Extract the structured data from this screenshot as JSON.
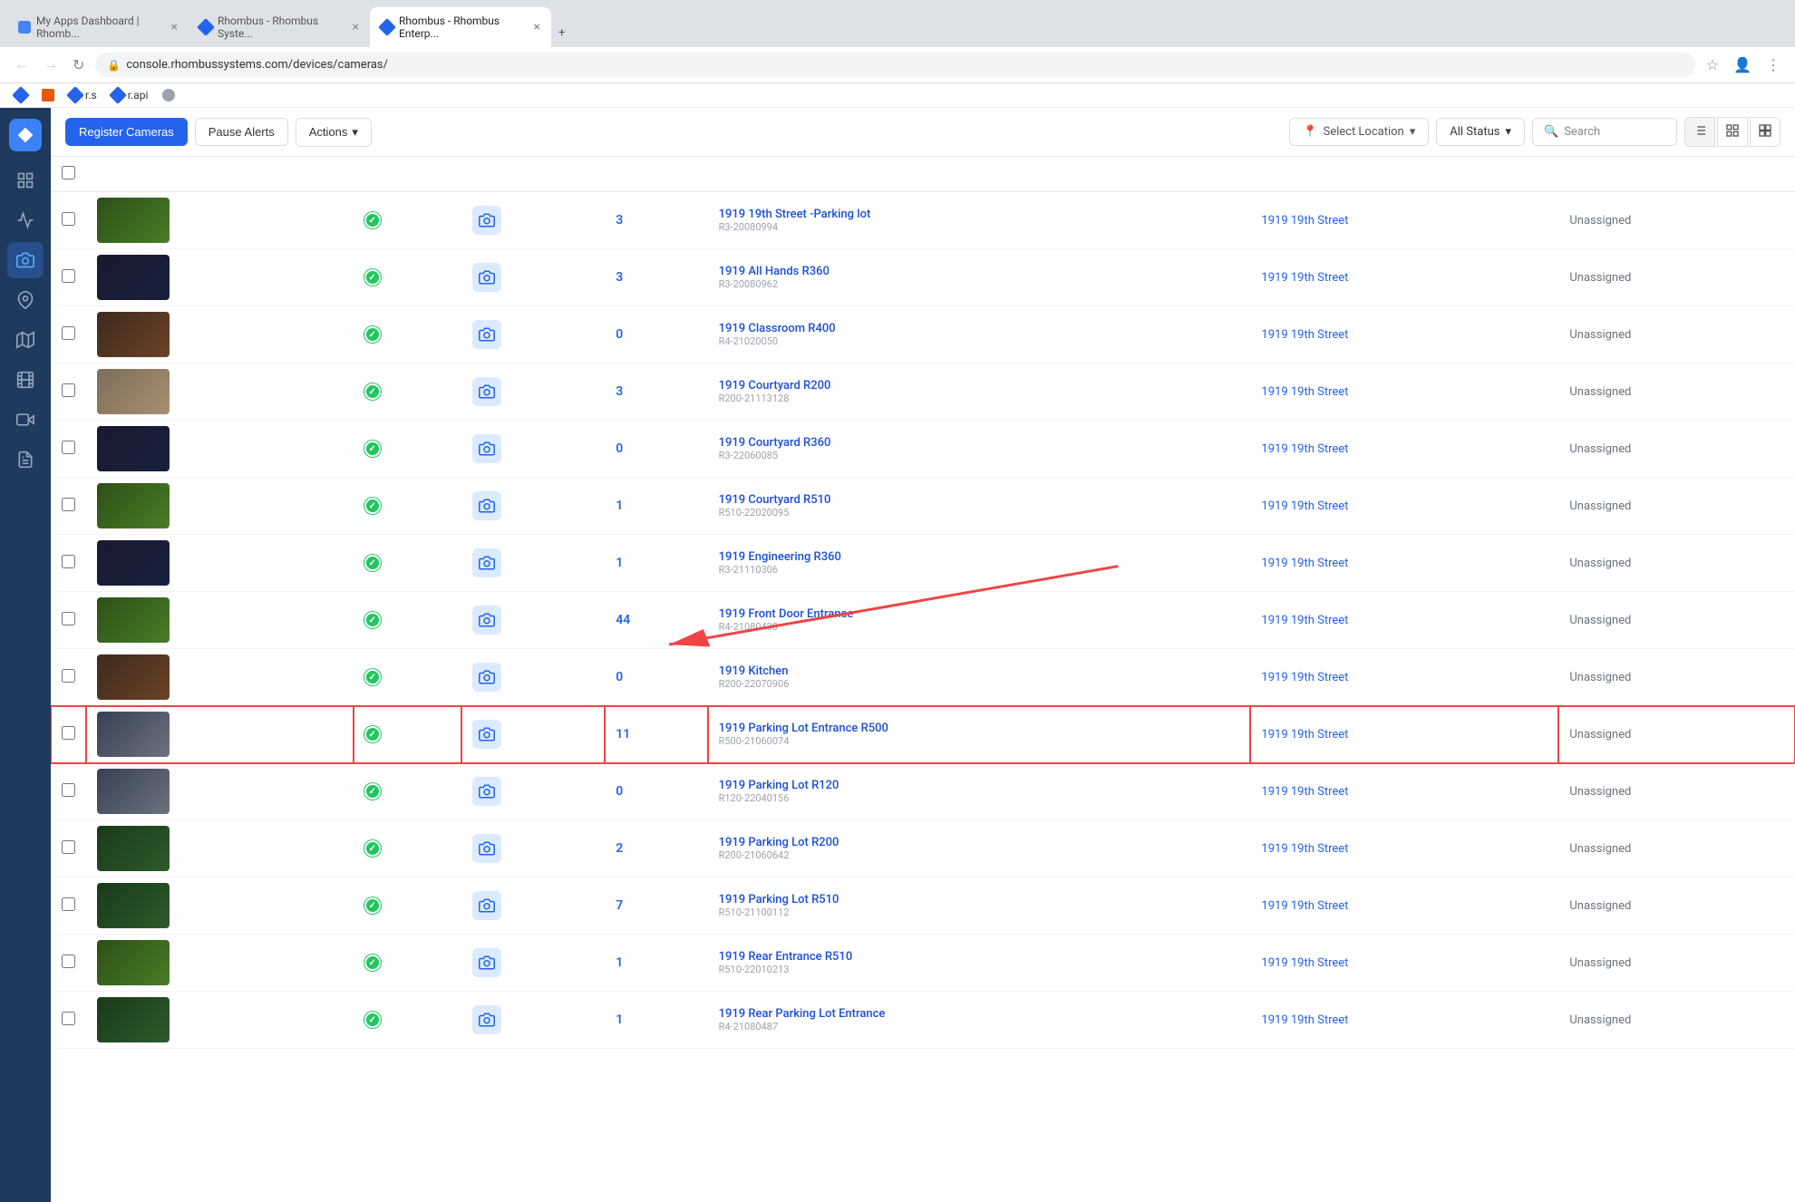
{
  "browser": {
    "tabs": [
      {
        "label": "My Apps Dashboard | Rhomb...",
        "active": false,
        "favicon": "app"
      },
      {
        "label": "Rhombus - Rhombus Syste...",
        "active": false,
        "favicon": "rhombus"
      },
      {
        "label": "Rhombus - Rhombus Enterp...",
        "active": true,
        "favicon": "rhombus"
      }
    ],
    "url": "console.rhombussystems.com/devices/cameras/",
    "bookmarks": [
      {
        "label": "r.s"
      },
      {
        "label": "r.api"
      }
    ]
  },
  "toolbar": {
    "register_label": "Register Cameras",
    "pause_label": "Pause Alerts",
    "actions_label": "Actions",
    "location_placeholder": "Select Location",
    "status_label": "All Status",
    "search_placeholder": "Search"
  },
  "cameras": [
    {
      "id": 1,
      "name": "1919 19th Street -Parking lot",
      "device_id": "R3-20080994",
      "count": "3",
      "location": "1919 19th Street",
      "status": "Unassigned",
      "thumb_style": "thumb-outdoor",
      "online": true,
      "highlighted": false
    },
    {
      "id": 2,
      "name": "1919 All Hands R360",
      "device_id": "R3-20080962",
      "count": "3",
      "location": "1919 19th Street",
      "status": "Unassigned",
      "thumb_style": "thumb-dark",
      "online": true,
      "highlighted": false
    },
    {
      "id": 3,
      "name": "1919 Classroom R400",
      "device_id": "R4-21020050",
      "count": "0",
      "location": "1919 19th Street",
      "status": "Unassigned",
      "thumb_style": "thumb-indoor",
      "online": true,
      "highlighted": false
    },
    {
      "id": 4,
      "name": "1919 Courtyard R200",
      "device_id": "R200-21113128",
      "count": "3",
      "location": "1919 19th Street",
      "status": "Unassigned",
      "thumb_style": "thumb-bright",
      "online": true,
      "highlighted": false
    },
    {
      "id": 5,
      "name": "1919 Courtyard R360",
      "device_id": "R3-22060085",
      "count": "0",
      "location": "1919 19th Street",
      "status": "Unassigned",
      "thumb_style": "thumb-dark",
      "online": true,
      "highlighted": false
    },
    {
      "id": 6,
      "name": "1919 Courtyard R510",
      "device_id": "R510-22020095",
      "count": "1",
      "location": "1919 19th Street",
      "status": "Unassigned",
      "thumb_style": "thumb-outdoor",
      "online": true,
      "highlighted": false
    },
    {
      "id": 7,
      "name": "1919 Engineering R360",
      "device_id": "R3-21110306",
      "count": "1",
      "location": "1919 19th Street",
      "status": "Unassigned",
      "thumb_style": "thumb-dark",
      "online": true,
      "highlighted": false
    },
    {
      "id": 8,
      "name": "1919 Front Door Entrance",
      "device_id": "R4-21080430",
      "count": "44",
      "location": "1919 19th Street",
      "status": "Unassigned",
      "thumb_style": "thumb-outdoor",
      "online": true,
      "highlighted": false
    },
    {
      "id": 9,
      "name": "1919 Kitchen",
      "device_id": "R200-22070906",
      "count": "0",
      "location": "1919 19th Street",
      "status": "Unassigned",
      "thumb_style": "thumb-indoor",
      "online": true,
      "highlighted": false
    },
    {
      "id": 10,
      "name": "1919 Parking Lot Entrance R500",
      "device_id": "R500-21060074",
      "count": "11",
      "location": "1919 19th Street",
      "status": "Unassigned",
      "thumb_style": "thumb-parking",
      "online": true,
      "highlighted": true
    },
    {
      "id": 11,
      "name": "1919 Parking Lot R120",
      "device_id": "R120-22040156",
      "count": "0",
      "location": "1919 19th Street",
      "status": "Unassigned",
      "thumb_style": "thumb-parking",
      "online": true,
      "highlighted": false
    },
    {
      "id": 12,
      "name": "1919 Parking Lot R200",
      "device_id": "R200-21060642",
      "count": "2",
      "location": "1919 19th Street",
      "status": "Unassigned",
      "thumb_style": "thumb-green",
      "online": true,
      "highlighted": false
    },
    {
      "id": 13,
      "name": "1919 Parking Lot R510",
      "device_id": "R510-21100112",
      "count": "7",
      "location": "1919 19th Street",
      "status": "Unassigned",
      "thumb_style": "thumb-green",
      "online": true,
      "highlighted": false
    },
    {
      "id": 14,
      "name": "1919 Rear Entrance R510",
      "device_id": "R510-22010213",
      "count": "1",
      "location": "1919 19th Street",
      "status": "Unassigned",
      "thumb_style": "thumb-outdoor",
      "online": true,
      "highlighted": false
    },
    {
      "id": 15,
      "name": "1919 Rear Parking Lot Entrance",
      "device_id": "R4-21080487",
      "count": "1",
      "location": "1919 19th Street",
      "status": "Unassigned",
      "thumb_style": "thumb-green",
      "online": true,
      "highlighted": false
    }
  ],
  "sidebar": {
    "items": [
      {
        "icon": "grid",
        "label": "Dashboard",
        "active": false
      },
      {
        "icon": "chart",
        "label": "Analytics",
        "active": false
      },
      {
        "icon": "camera",
        "label": "Cameras",
        "active": true
      },
      {
        "icon": "map-pin",
        "label": "Locations",
        "active": false
      },
      {
        "icon": "map",
        "label": "Maps",
        "active": false
      },
      {
        "icon": "film",
        "label": "Recordings",
        "active": false
      },
      {
        "icon": "video",
        "label": "Video Walls",
        "active": false
      },
      {
        "icon": "file-text",
        "label": "Reports",
        "active": false
      }
    ]
  }
}
